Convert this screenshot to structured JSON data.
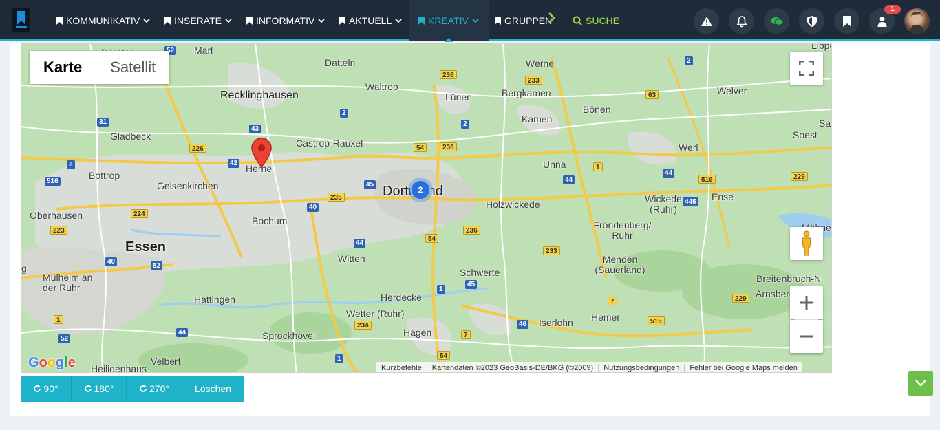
{
  "nav": {
    "items": [
      {
        "label": "KOMMUNIKATIV"
      },
      {
        "label": "INSERATE"
      },
      {
        "label": "INFORMATIV"
      },
      {
        "label": "AKTUELL"
      },
      {
        "label": "KREATIV"
      },
      {
        "label": "GRUPPEN"
      }
    ],
    "search_label": "SUCHE",
    "notification_badge": "1",
    "accent_color": "#1fb3c9",
    "search_color": "#9ee04a"
  },
  "map": {
    "map_types": [
      "Karte",
      "Satellit"
    ],
    "selected_map_type": "Karte",
    "cluster_count": "2",
    "places": [
      "Marl",
      "Dorsten",
      "Datteln",
      "Waltrop",
      "Lünen",
      "Werne",
      "Bergkamen",
      "Bönen",
      "Welver",
      "Lippe",
      "Recklinghausen",
      "Gladbeck",
      "Castrop-Rauxel",
      "Kamen",
      "Soest",
      "Herne",
      "Bottrop",
      "Gelsenkirchen",
      "Dortmund",
      "Unna",
      "Werl",
      "Sas",
      "Oberhausen",
      "Essen",
      "Bochum",
      "Holzwickede",
      "Wickede (Ruhr)",
      "Ense",
      "Fröndenberg/ Ruhr",
      "Möhnese",
      "Mülheim an der Ruhr",
      "Witten",
      "Schwerte",
      "Menden (Sauerland)",
      "Hattingen",
      "Herdecke",
      "Breitenbruch-N",
      "Arnsberg",
      "Wetter (Ruhr)",
      "Hemer",
      "Iserlohn",
      "Sprockhövel",
      "Hagen",
      "Velbert",
      "Heiligenhaus",
      "g"
    ],
    "roads": [
      "52",
      "2",
      "236",
      "233",
      "2",
      "63",
      "31",
      "43",
      "2",
      "2",
      "226",
      "42",
      "54",
      "236",
      "1",
      "2",
      "516",
      "45",
      "44",
      "516",
      "229",
      "40",
      "235",
      "445",
      "224",
      "44",
      "54",
      "236",
      "223",
      "40",
      "52",
      "44",
      "233",
      "1",
      "45",
      "7",
      "229",
      "234",
      "46",
      "515",
      "1",
      "44",
      "52",
      "7",
      "54",
      "1"
    ],
    "logo": "Google",
    "attribution": [
      "Kurzbefehle",
      "Kartendaten ©2023 GeoBasis-DE/BKG (©2009)",
      "Nutzungsbedingungen",
      "Fehler bei Google Maps melden"
    ]
  },
  "rotate_buttons": [
    {
      "label": "90°"
    },
    {
      "label": "180°"
    },
    {
      "label": "270°"
    }
  ],
  "delete_label": "Löschen"
}
